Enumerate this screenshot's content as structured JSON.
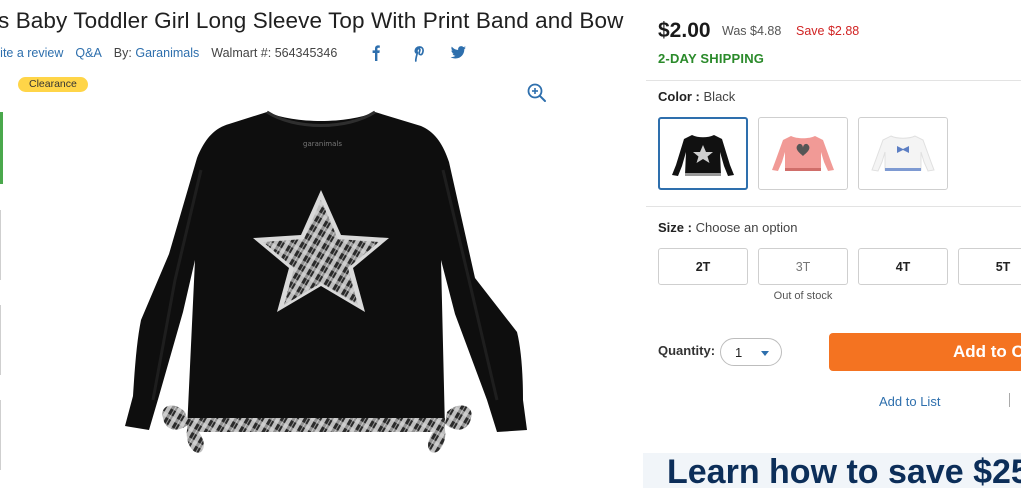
{
  "product": {
    "title": "s Baby Toddler Girl Long Sleeve Top With Print Band and Bow",
    "write_review": "rite a review",
    "qa": "Q&A",
    "by_label": "By:",
    "brand": "Garanimals",
    "walmart_number": "Walmart #: 564345346",
    "badge": "Clearance"
  },
  "social": {
    "icons": [
      "facebook-icon",
      "pinterest-icon",
      "twitter-icon"
    ]
  },
  "pricing": {
    "price": "$2.00",
    "was": "Was $4.88",
    "save": "Save $2.88",
    "shipping": "2-DAY SHIPPING"
  },
  "color": {
    "label": "Color :",
    "value": "Black",
    "swatches": [
      "black-star-top",
      "pink-sequin-top",
      "white-bow-top"
    ],
    "selected_index": 0
  },
  "size": {
    "label": "Size :",
    "placeholder": "Choose an option",
    "options": [
      "2T",
      "3T",
      "4T",
      "5T"
    ],
    "out_of_stock_note": "Out of stock"
  },
  "quantity": {
    "label": "Quantity:",
    "value": "1"
  },
  "actions": {
    "add_to_cart": "Add to Cart",
    "add_to_list": "Add to List"
  },
  "promo": {
    "headline": "Learn how to save $25"
  },
  "colors": {
    "accent_blue": "#2e6fad",
    "cta_orange": "#f47321",
    "shipping_green": "#2a8a2a",
    "save_red": "#d12424",
    "badge_yellow": "#ffd548",
    "promo_navy": "#0c2e59"
  }
}
